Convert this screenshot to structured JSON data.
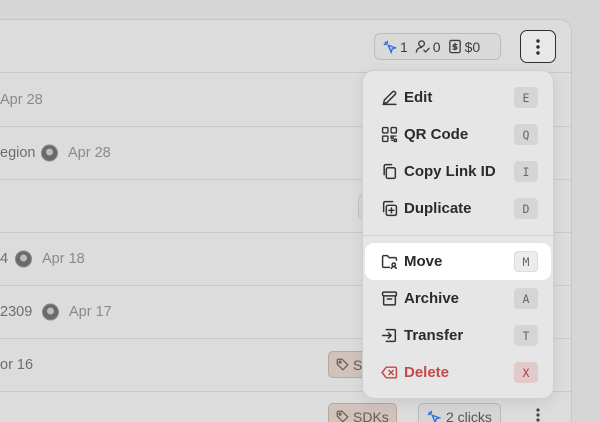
{
  "colors": {
    "accent": "#2f6fe0",
    "danger": "#c24a4a",
    "tag_bg": "#cfc3bb"
  },
  "header_stats": {
    "clicks": "1",
    "leads": "0",
    "sales": "$0"
  },
  "rows": [
    {
      "text": "",
      "date": "Apr 28"
    },
    {
      "text": "egion",
      "date": "Apr 28"
    },
    {
      "text": "",
      "date": ""
    },
    {
      "text": "4",
      "date": "Apr 18"
    },
    {
      "text": "2309",
      "date": "Apr 17"
    },
    {
      "text": "or 16",
      "date": "",
      "tag": "S"
    },
    {
      "text": "",
      "date": "",
      "tag": "SDKs",
      "clicks": "2 clicks"
    }
  ],
  "menu": {
    "items": [
      {
        "label": "Edit",
        "shortcut": "E",
        "icon": "pencil-icon"
      },
      {
        "label": "QR Code",
        "shortcut": "Q",
        "icon": "qr-code-icon"
      },
      {
        "label": "Copy Link ID",
        "shortcut": "I",
        "icon": "copy-icon"
      },
      {
        "label": "Duplicate",
        "shortcut": "D",
        "icon": "duplicate-icon"
      },
      {
        "label": "Move",
        "shortcut": "M",
        "icon": "folder-move-icon"
      },
      {
        "label": "Archive",
        "shortcut": "A",
        "icon": "archive-icon"
      },
      {
        "label": "Transfer",
        "shortcut": "T",
        "icon": "transfer-icon"
      },
      {
        "label": "Delete",
        "shortcut": "X",
        "icon": "delete-icon"
      }
    ]
  }
}
